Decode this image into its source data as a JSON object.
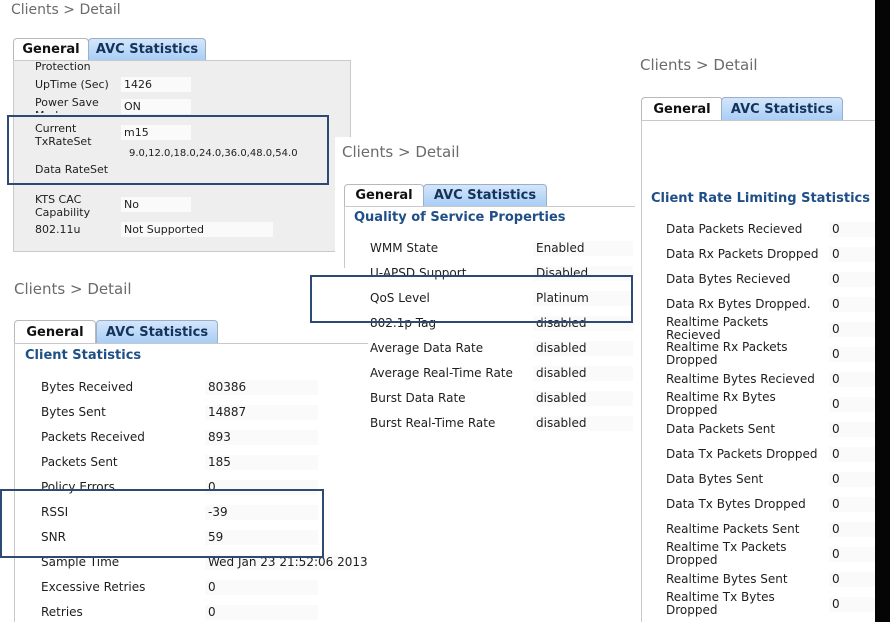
{
  "breadcrumb": "Clients > Detail",
  "tabs": {
    "general": "General",
    "avc": "AVC Statistics"
  },
  "panel1": {
    "rows": [
      {
        "label": "Protection",
        "value": ""
      },
      {
        "label": "UpTime (Sec)",
        "value": "1426"
      },
      {
        "label": "Power Save Mode",
        "value": "ON"
      },
      {
        "label": "Current TxRateSet",
        "value": "m15"
      },
      {
        "label": "Data RateSet",
        "value": "9.0,12.0,18.0,24.0,36.0,48.0,54.0"
      },
      {
        "label": "KTS CAC Capability",
        "value": "No"
      },
      {
        "label": "802.11u",
        "value": "Not Supported"
      }
    ]
  },
  "panel2": {
    "title": "Quality of Service Properties",
    "rows": [
      {
        "label": "WMM State",
        "value": "Enabled"
      },
      {
        "label": "U-APSD Support",
        "value": "Disabled"
      },
      {
        "label": "QoS Level",
        "value": "Platinum"
      },
      {
        "label": "802.1p Tag",
        "value": "disabled"
      },
      {
        "label": "Average Data Rate",
        "value": "disabled"
      },
      {
        "label": "Average Real-Time Rate",
        "value": "disabled"
      },
      {
        "label": "Burst Data Rate",
        "value": "disabled"
      },
      {
        "label": "Burst Real-Time Rate",
        "value": "disabled"
      }
    ]
  },
  "panel3": {
    "title": "Client Statistics",
    "rows": [
      {
        "label": "Bytes Received",
        "value": "80386"
      },
      {
        "label": "Bytes Sent",
        "value": "14887"
      },
      {
        "label": "Packets Received",
        "value": "893"
      },
      {
        "label": "Packets Sent",
        "value": "185"
      },
      {
        "label": "Policy Errors",
        "value": "0"
      },
      {
        "label": "RSSI",
        "value": "-39"
      },
      {
        "label": "SNR",
        "value": "59"
      },
      {
        "label": "Sample Time",
        "value": "Wed Jan 23 21:52:06 2013"
      },
      {
        "label": "Excessive Retries",
        "value": "0"
      },
      {
        "label": "Retries",
        "value": "0"
      }
    ]
  },
  "panel4": {
    "title": "Client Rate Limiting Statistics",
    "rows": [
      {
        "label": "Data Packets Recieved",
        "value": "0"
      },
      {
        "label": "Data Rx Packets Dropped",
        "value": "0"
      },
      {
        "label": "Data Bytes Recieved",
        "value": "0"
      },
      {
        "label": "Data Rx Bytes Dropped.",
        "value": "0"
      },
      {
        "label": "Realtime Packets Recieved",
        "value": "0"
      },
      {
        "label": "Realtime Rx Packets Dropped",
        "value": "0"
      },
      {
        "label": "Realtime Bytes Recieved",
        "value": "0"
      },
      {
        "label": "Realtime Rx Bytes Dropped",
        "value": "0"
      },
      {
        "label": "Data Packets Sent",
        "value": "0"
      },
      {
        "label": "Data Tx Packets Dropped",
        "value": "0"
      },
      {
        "label": "Data Bytes Sent",
        "value": "0"
      },
      {
        "label": "Data Tx Bytes Dropped",
        "value": "0"
      },
      {
        "label": "Realtime Packets Sent",
        "value": "0"
      },
      {
        "label": "Realtime Tx Packets Dropped",
        "value": "0"
      },
      {
        "label": "Realtime Bytes Sent",
        "value": "0"
      },
      {
        "label": "Realtime Tx Bytes Dropped",
        "value": "0"
      }
    ]
  }
}
